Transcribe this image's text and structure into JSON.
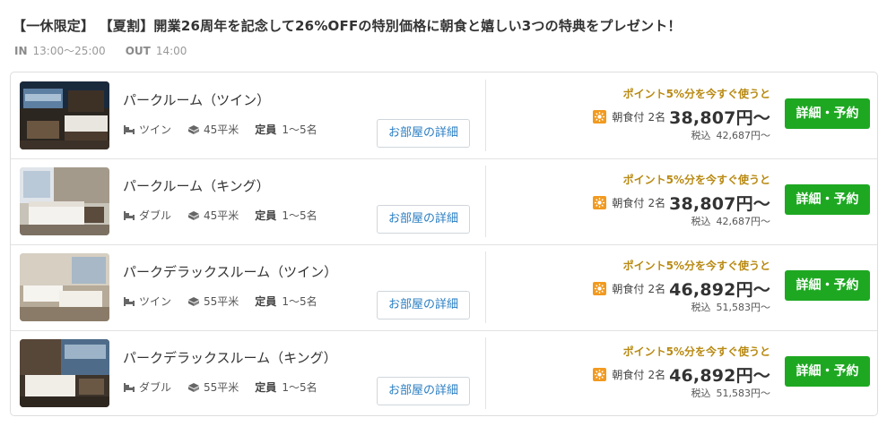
{
  "plan": {
    "title": "【一休限定】 【夏割】開業26周年を記念して26%OFFの特別価格に朝食と嬉しい3つの特典をプレゼント！",
    "checkin_label": "IN",
    "checkin_time": "13:00〜25:00",
    "checkout_label": "OUT",
    "checkout_time": "14:00"
  },
  "labels": {
    "capacity_label": "定員",
    "detail_button": "お部屋の詳細",
    "points_promo": "ポイント5%分を今すぐ使うと",
    "meal": "朝食付",
    "tax_label": "税込",
    "book_button": "詳細・予約"
  },
  "colors": {
    "accent_gold": "#b98a13",
    "book_green": "#1ea822",
    "breakfast_orange": "#f29a1f",
    "link_blue": "#2a7ec2"
  },
  "rooms": [
    {
      "name": "パークルーム（ツイン）",
      "bed": "ツイン",
      "size": "45平米",
      "capacity": "1〜5名",
      "guests": "2名",
      "price": "38,807円〜",
      "tax_price": "42,687円〜"
    },
    {
      "name": "パークルーム（キング）",
      "bed": "ダブル",
      "size": "45平米",
      "capacity": "1〜5名",
      "guests": "2名",
      "price": "38,807円〜",
      "tax_price": "42,687円〜"
    },
    {
      "name": "パークデラックスルーム（ツイン）",
      "bed": "ツイン",
      "size": "55平米",
      "capacity": "1〜5名",
      "guests": "2名",
      "price": "46,892円〜",
      "tax_price": "51,583円〜"
    },
    {
      "name": "パークデラックスルーム（キング）",
      "bed": "ダブル",
      "size": "55平米",
      "capacity": "1〜5名",
      "guests": "2名",
      "price": "46,892円〜",
      "tax_price": "51,583円〜"
    }
  ]
}
